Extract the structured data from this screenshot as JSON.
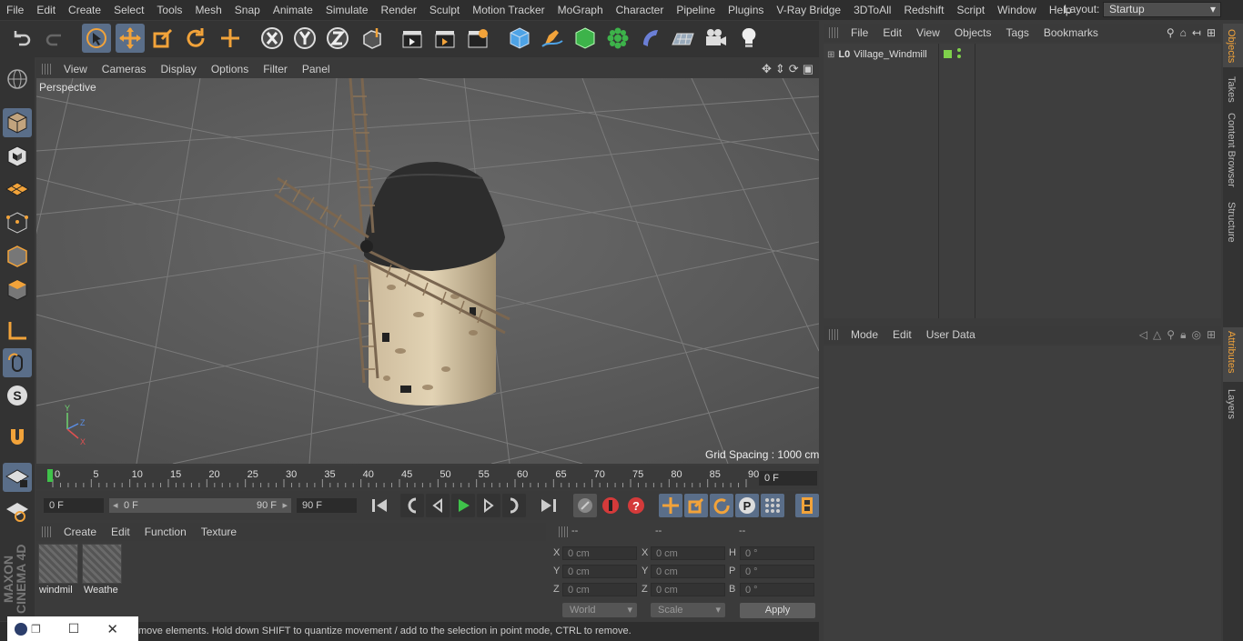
{
  "menubar": {
    "items": [
      "File",
      "Edit",
      "Create",
      "Select",
      "Tools",
      "Mesh",
      "Snap",
      "Animate",
      "Simulate",
      "Render",
      "Sculpt",
      "Motion Tracker",
      "MoGraph",
      "Character",
      "Pipeline",
      "Plugins",
      "V-Ray Bridge",
      "3DToAll",
      "Redshift",
      "Script",
      "Window",
      "Help"
    ],
    "layout_label": "Layout:",
    "layout_value": "Startup"
  },
  "viewport": {
    "menu": [
      "View",
      "Cameras",
      "Display",
      "Options",
      "Filter",
      "Panel"
    ],
    "camera_label": "Perspective",
    "grid_spacing": "Grid Spacing : 1000 cm"
  },
  "timeline": {
    "ticks": [
      "0",
      "5",
      "10",
      "15",
      "20",
      "25",
      "30",
      "35",
      "40",
      "45",
      "50",
      "55",
      "60",
      "65",
      "70",
      "75",
      "80",
      "85",
      "90"
    ],
    "current_frame": "0 F"
  },
  "transport": {
    "start_field": "0 F",
    "range_start": "0 F",
    "range_end": "90 F",
    "end_field": "90 F"
  },
  "material_manager": {
    "menu": [
      "Create",
      "Edit",
      "Function",
      "Texture"
    ],
    "materials": [
      "windmil",
      "Weathe"
    ]
  },
  "coordinates": {
    "col_headers": [
      "--",
      "--",
      "--"
    ],
    "rows": [
      {
        "pos_label": "X",
        "pos": "0 cm",
        "size_label": "X",
        "size": "0 cm",
        "rot_label": "H",
        "rot": "0 °"
      },
      {
        "pos_label": "Y",
        "pos": "0 cm",
        "size_label": "Y",
        "size": "0 cm",
        "rot_label": "P",
        "rot": "0 °"
      },
      {
        "pos_label": "Z",
        "pos": "0 cm",
        "size_label": "Z",
        "size": "0 cm",
        "rot_label": "B",
        "rot": "0 °"
      }
    ],
    "mode_world": "World",
    "mode_scale": "Scale",
    "apply_label": "Apply"
  },
  "status": {
    "text": "move elements. Hold down SHIFT to quantize movement / add to the selection in point mode, CTRL to remove."
  },
  "branding": {
    "logo_text": "MAXON CINEMA 4D"
  },
  "object_manager": {
    "menu": [
      "File",
      "Edit",
      "View",
      "Objects",
      "Tags",
      "Bookmarks"
    ],
    "objects": [
      {
        "name": "Village_Windmill"
      }
    ]
  },
  "attribute_manager": {
    "menu": [
      "Mode",
      "Edit",
      "User Data"
    ]
  },
  "right_tabs": [
    "Objects",
    "Takes",
    "Content Browser",
    "Structure",
    "Attributes",
    "Layers"
  ],
  "colors": {
    "accent": "#5a6e89",
    "orange": "#f2a33a",
    "status_green": "#7fd14b"
  }
}
